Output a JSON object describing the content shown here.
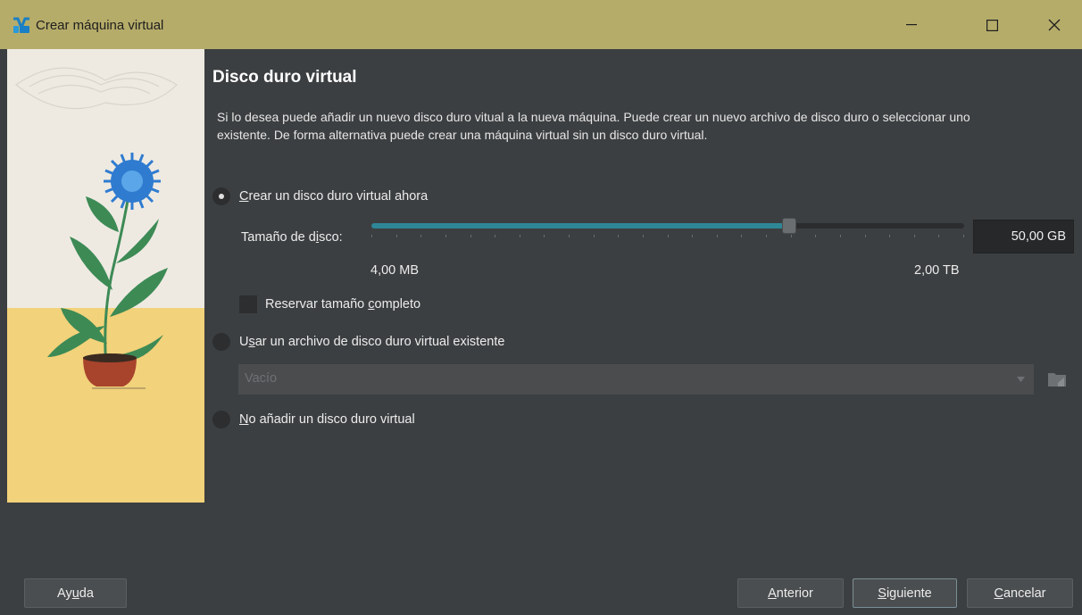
{
  "window": {
    "title": "Crear máquina virtual",
    "minimize_glyph": "–",
    "maximize_glyph": "☐",
    "close_glyph": "✕"
  },
  "page": {
    "heading": "Disco duro virtual",
    "description": "Si lo desea puede añadir un nuevo disco duro vitual a la nueva máquina. Puede crear un nuevo archivo de disco duro o seleccionar uno existente. De forma alternativa puede crear una máquina virtual sin un disco duro virtual."
  },
  "options": {
    "create": {
      "pre": "",
      "mnemonic": "C",
      "post": "rear un disco duro virtual ahora",
      "selected": true
    },
    "existing": {
      "pre": "U",
      "mnemonic": "s",
      "post": "ar un archivo de disco duro virtual existente",
      "selected": false
    },
    "none": {
      "pre": "",
      "mnemonic": "N",
      "post": "o añadir un disco duro virtual",
      "selected": false
    }
  },
  "disk_size": {
    "label_pre": "Tamaño de d",
    "label_mnemonic": "i",
    "label_post": "sco:",
    "value": "50,00 GB",
    "min_label": "4,00 MB",
    "max_label": "2,00 TB",
    "slider_fraction": 0.705
  },
  "reserve": {
    "label_pre": "Reservar tamaño ",
    "label_mnemonic": "c",
    "label_post": "ompleto",
    "checked": false
  },
  "existing_disk": {
    "placeholder": "Vacío"
  },
  "buttons": {
    "help": {
      "pre": "Ay",
      "mnemonic": "u",
      "post": "da"
    },
    "back": {
      "pre": "",
      "mnemonic": "A",
      "post": "nterior"
    },
    "next": {
      "pre": "",
      "mnemonic": "S",
      "post": "iguiente"
    },
    "cancel": {
      "pre": "",
      "mnemonic": "C",
      "post": "ancelar"
    }
  },
  "colors": {
    "titlebar": "#b6ac6a",
    "background": "#3c3f41",
    "accent": "#2e8796"
  }
}
